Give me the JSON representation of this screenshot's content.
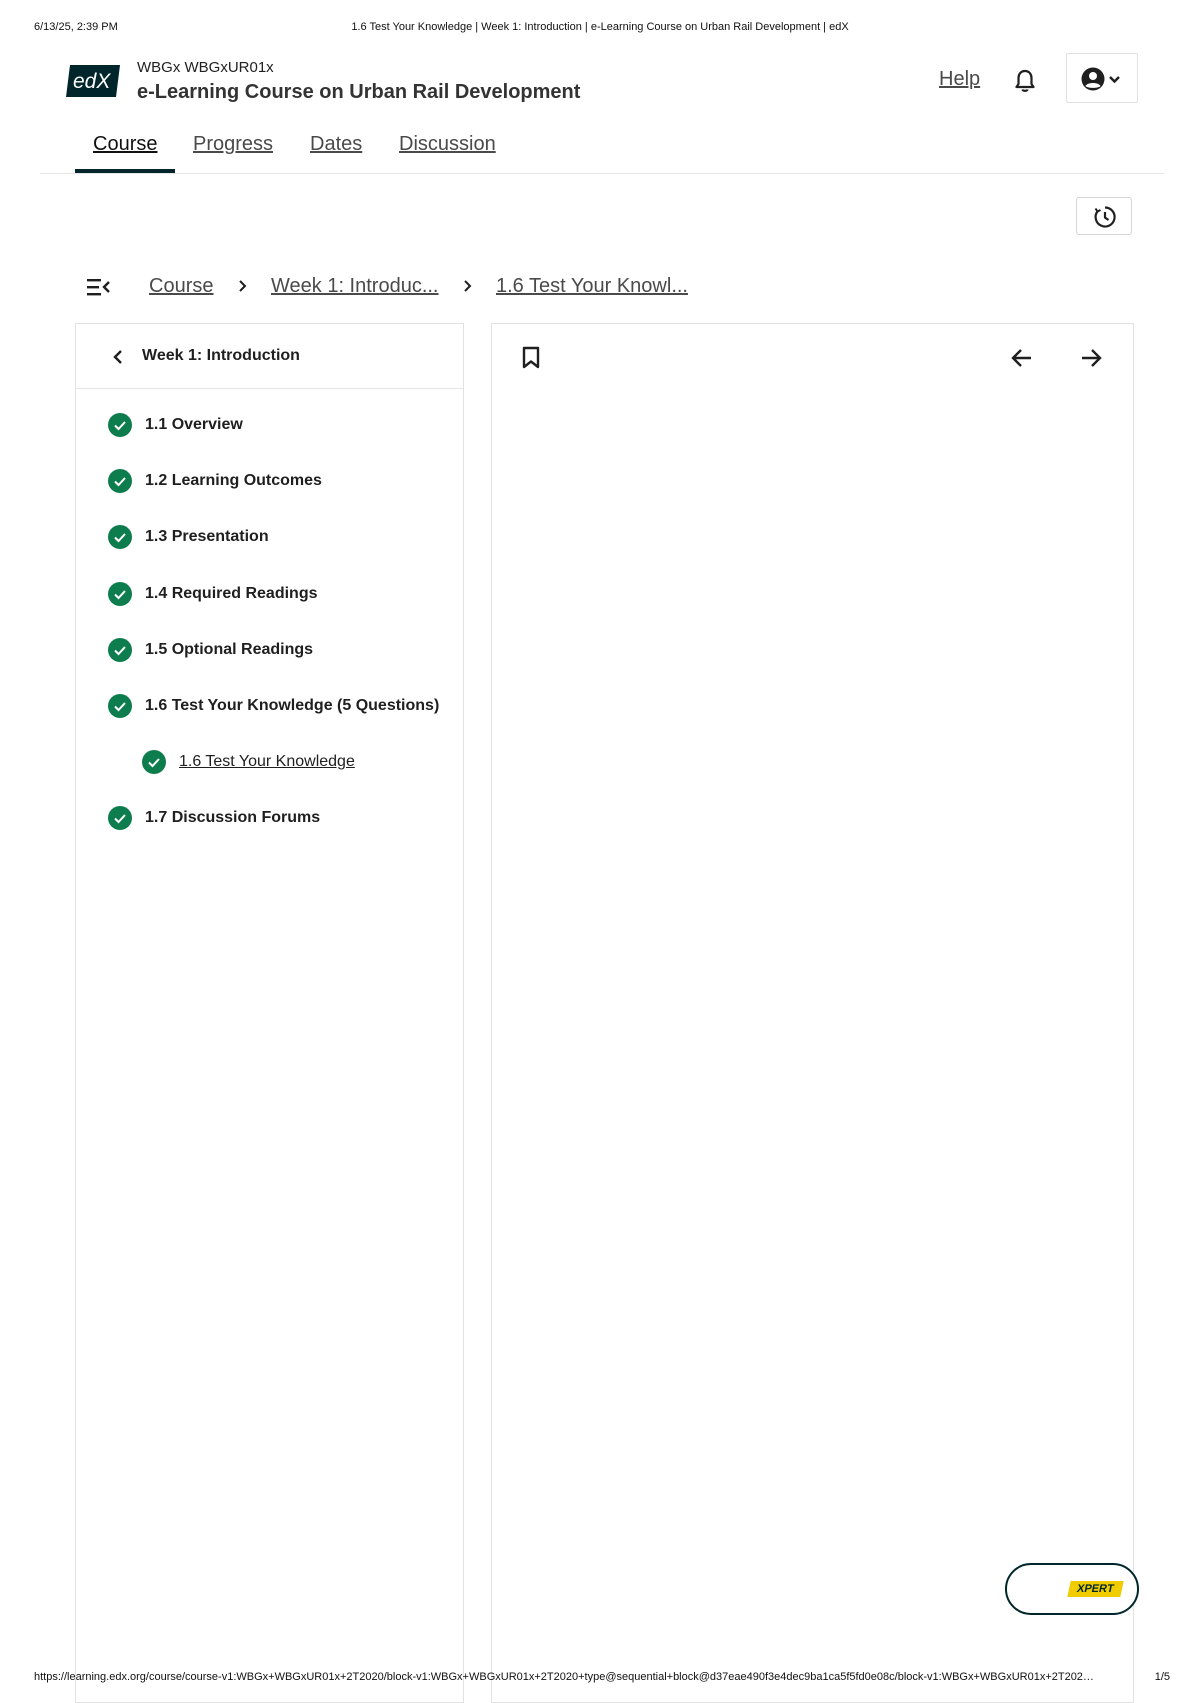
{
  "print": {
    "date": "6/13/25, 2:39 PM",
    "title": "1.6 Test Your Knowledge | Week 1: Introduction | e-Learning Course on Urban Rail Development | edX",
    "url": "https://learning.edx.org/course/course-v1:WBGx+WBGxUR01x+2T2020/block-v1:WBGx+WBGxUR01x+2T2020+type@sequential+block@d37eae490f3e4dec9ba1ca5f5fd0e08c/block-v1:WBGx+WBGxUR01x+2T202…",
    "page": "1/5"
  },
  "header": {
    "logo_text": "edX",
    "org_code": "WBGx WBGxUR01x",
    "course_title": "e-Learning Course on Urban Rail Development",
    "help_label": "Help",
    "bell_icon": "bell-icon",
    "user_icon": "user-avatar-icon"
  },
  "nav": {
    "tabs": [
      {
        "label": "Course",
        "active": true
      },
      {
        "label": "Progress",
        "active": false
      },
      {
        "label": "Dates",
        "active": false
      },
      {
        "label": "Discussion",
        "active": false
      }
    ]
  },
  "toolbar": {
    "history_icon": "history-icon"
  },
  "breadcrumb": {
    "items": [
      "Course",
      "Week 1: Introduc...",
      "1.6 Test Your Knowl..."
    ]
  },
  "sidebar": {
    "title": "Week 1: Introduction",
    "items": [
      {
        "label": "1.1 Overview",
        "completed": true
      },
      {
        "label": "1.2 Learning Outcomes",
        "completed": true
      },
      {
        "label": "1.3 Presentation",
        "completed": true
      },
      {
        "label": "1.4 Required Readings",
        "completed": true
      },
      {
        "label": "1.5 Optional Readings",
        "completed": true
      },
      {
        "label": "1.6 Test Your Knowledge (5 Questions)",
        "completed": true
      },
      {
        "label": "1.6 Test Your Knowledge",
        "completed": true,
        "current": true
      },
      {
        "label": "1.7 Discussion Forums",
        "completed": true
      }
    ]
  },
  "content": {
    "bookmark_icon": "bookmark-icon",
    "prev_icon": "arrow-left-icon",
    "next_icon": "arrow-right-icon"
  },
  "xpert": {
    "label": "XPERT"
  },
  "colors": {
    "brand_dark": "#00262b",
    "success_green": "#0d7d4d",
    "xpert_yellow": "#f0cc00"
  }
}
